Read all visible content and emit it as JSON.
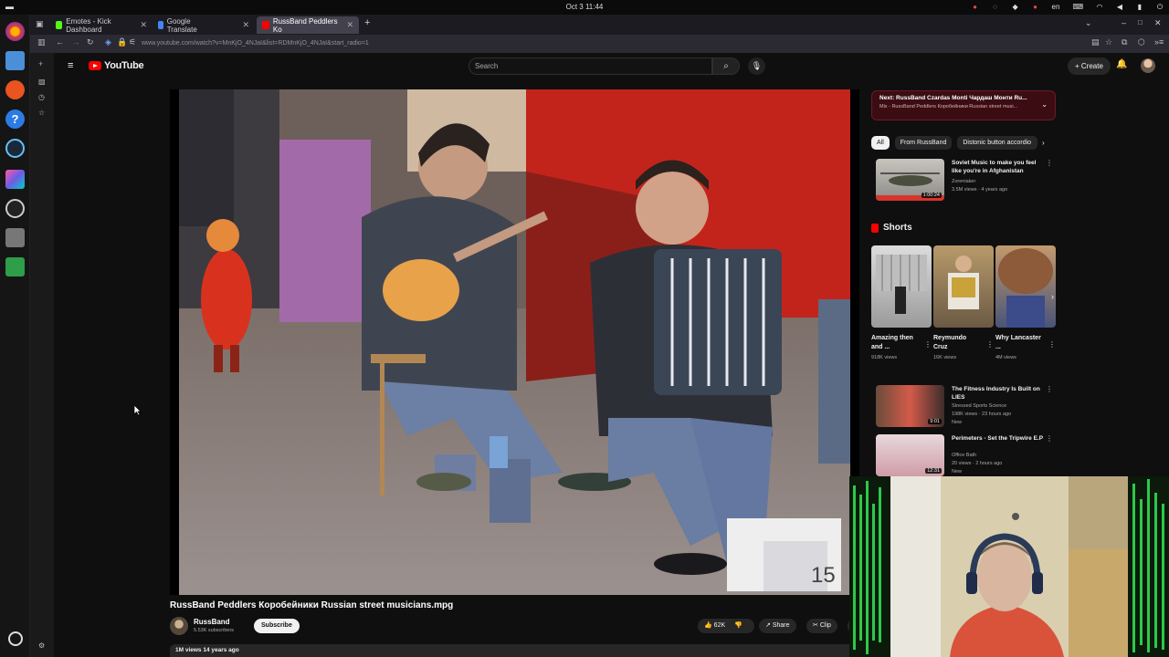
{
  "os": {
    "clock": "Oct 3  11:44",
    "lang": "en"
  },
  "browser": {
    "tabs": [
      {
        "title": "Emotes - Kick Dashboard",
        "favicon_color": "#53fc18"
      },
      {
        "title": "Google Translate",
        "favicon_color": "#4285f4"
      },
      {
        "title": "RussBand Peddlers Ko",
        "favicon_color": "#ff0000",
        "active": true
      }
    ],
    "url": "www.youtube.com/watch?v=MnKjO_4NJaI&list=RDMnKjO_4NJaI&start_radio=1"
  },
  "youtube": {
    "logo_text": "YouTube",
    "search_placeholder": "Search",
    "create_label": "Create",
    "video": {
      "title": "RussBand Peddlers Коробейники Russian street musicians.mpg",
      "channel": "RussBand",
      "subscribers": "5.53K subscribers",
      "subscribe_label": "Subscribe",
      "likes": "62K",
      "share_label": "Share",
      "clip_label": "Clip",
      "views_date": "1M views  14 years ago",
      "overlay_number": "15"
    },
    "next_card": {
      "title": "Next: RussBand Czardas Monti Чардаш Монти Ru...",
      "subtitle": "Mix - RussBand Peddlers Коробейники Russian street musi..."
    },
    "chips": [
      "All",
      "From RussBand",
      "Distonic button accordio"
    ],
    "recs": [
      {
        "title": "Soviet Music to make you feel like you're in Afghanistan",
        "channel": "Zoreniaker",
        "meta": "3.5M views · 4 years ago",
        "duration": "1:00:24"
      },
      {
        "title": "The Fitness Industry Is Built on LIES",
        "channel": "Stressed Sports Science",
        "meta": "198K views · 23 hours ago",
        "badge": "New",
        "duration": "9:01"
      },
      {
        "title": "Perimeters - Set the Tripwire E.P",
        "channel": "Office Bath",
        "meta": "20 views · 2 hours ago",
        "badge": "New",
        "duration": "12:31"
      }
    ],
    "shorts_header": "Shorts",
    "shorts": [
      {
        "title": "Amazing then and ...",
        "views": "918K views"
      },
      {
        "title": "Reymundo Cruz",
        "views": "16K views"
      },
      {
        "title": "Why Lancaster ...",
        "views": "4M views"
      }
    ]
  },
  "colors": {
    "accent": "#ff0000",
    "bg": "#0f0f0f"
  }
}
